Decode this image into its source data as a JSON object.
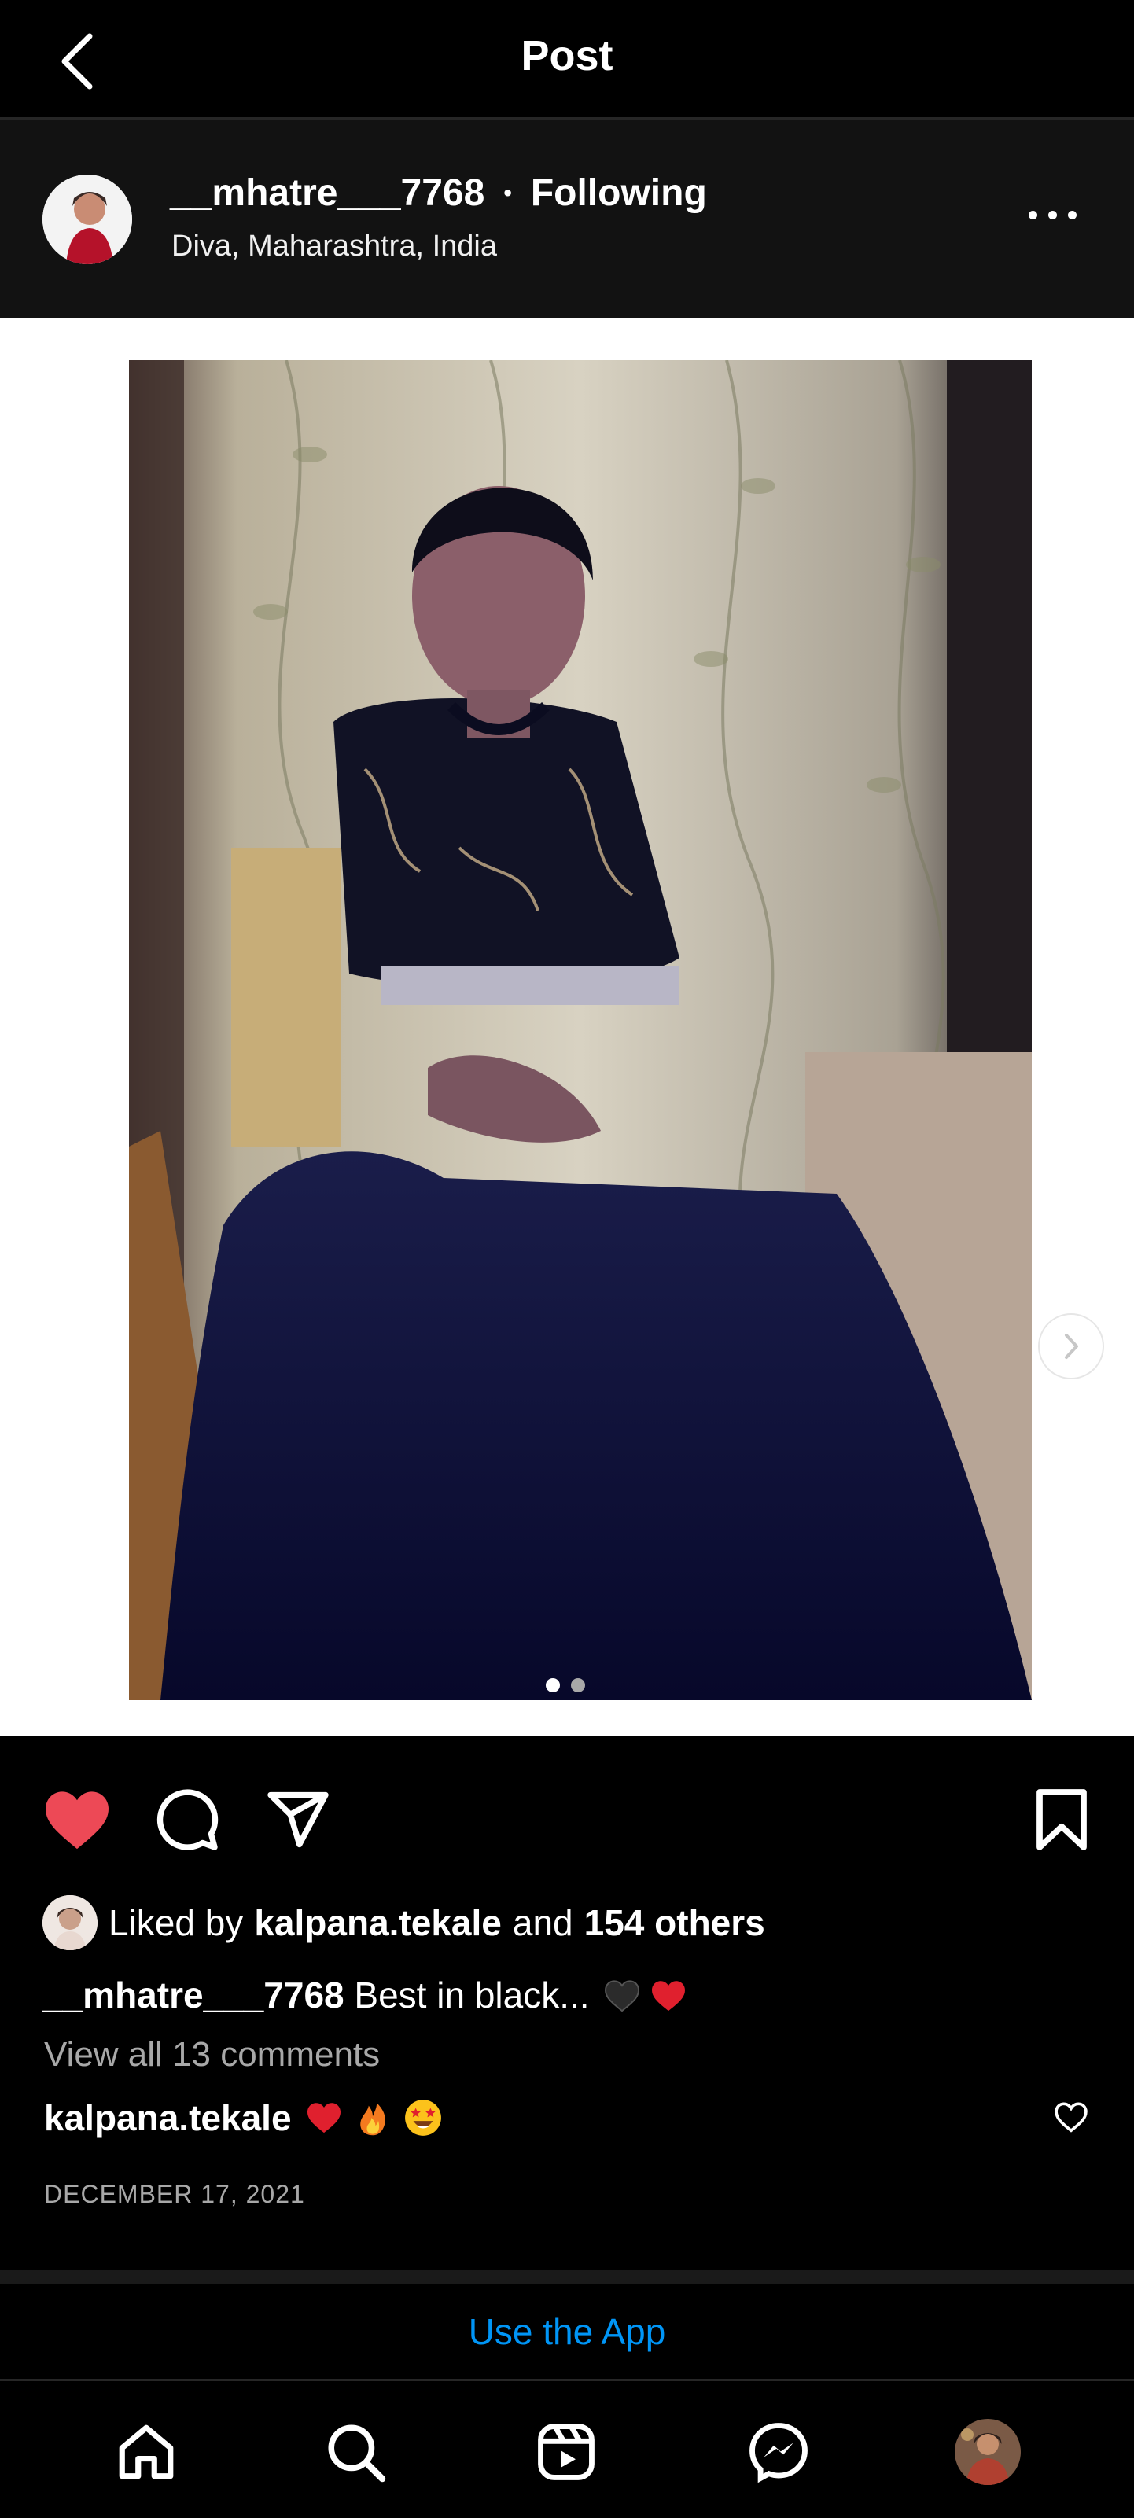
{
  "header": {
    "title": "Post"
  },
  "post": {
    "username": "__mhatre___7768",
    "separator": "•",
    "follow_state": "Following",
    "location": "Diva, Maharashtra, India",
    "carousel": {
      "count": 2,
      "active_index": 0
    },
    "liked": true,
    "likes": {
      "prefix": "Liked by",
      "user": "kalpana.tekale",
      "and": "and",
      "others": "154 others"
    },
    "caption": {
      "username": "__mhatre___7768",
      "text": "Best in black...",
      "emojis": [
        "black-heart",
        "red-heart"
      ]
    },
    "view_comments": "View all 13 comments",
    "top_comment": {
      "username": "kalpana.tekale",
      "emojis": [
        "red-heart",
        "fire",
        "star-struck"
      ]
    },
    "date": "DECEMBER 17, 2021"
  },
  "banner": {
    "cta": "Use the App"
  },
  "nav": {
    "tabs": [
      "home",
      "search",
      "reels",
      "messenger",
      "profile"
    ]
  },
  "colors": {
    "like_red": "#ed4956",
    "link_blue": "#0095f6",
    "background": "#000000",
    "header_bg": "#121212"
  }
}
